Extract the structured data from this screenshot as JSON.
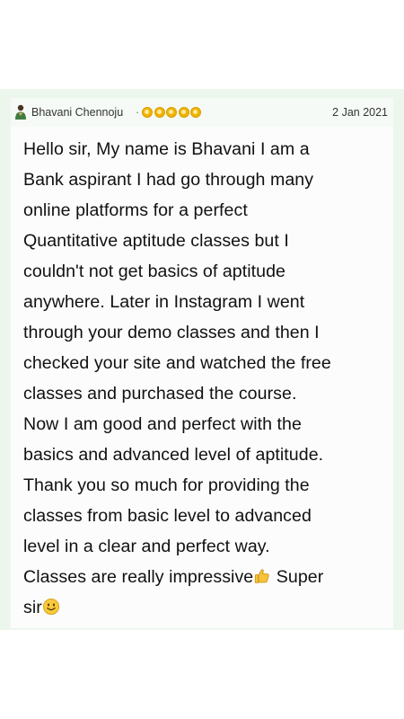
{
  "review": {
    "reviewer_name": "Bhavani Chennoju",
    "separator": "·",
    "rating": 5,
    "rating_icon": "star-icon",
    "date": "2 Jan 2021",
    "avatar_icon": "person-avatar-icon",
    "body_lines": [
      "Hello sir, My name is Bhavani I am a",
      "Bank aspirant I had go through many",
      "online platforms for a perfect",
      "Quantitative aptitude classes but I",
      "couldn't not get basics of aptitude",
      "anywhere. Later in Instagram I went",
      "through your demo classes and then I",
      "checked your site and watched the free",
      "classes and purchased the course.",
      "Now I am good and perfect with the",
      "basics and advanced level of aptitude.",
      "Thank you so much for providing the",
      "classes from basic level to advanced",
      "level in a clear and perfect way.",
      "Classes are really impressive",
      "Super",
      "sir"
    ],
    "emojis": [
      "thumbs-up-emoji-icon",
      "smiling-face-emoji-icon"
    ]
  },
  "colors": {
    "background": "#ffffff",
    "card_strip": "#edf6ed",
    "star_fill": "#f0b400",
    "text": "#111111"
  }
}
